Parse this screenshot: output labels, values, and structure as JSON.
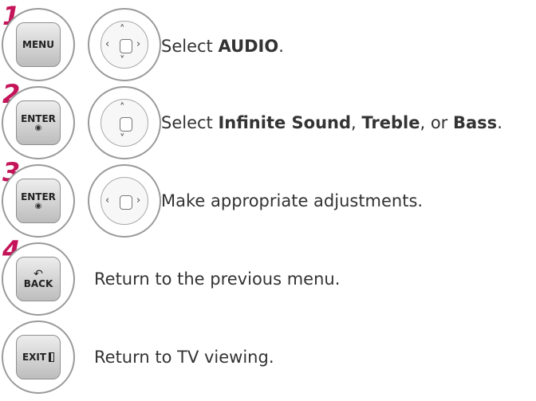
{
  "steps": [
    {
      "number": "1",
      "key_label": "MENU",
      "nav_arrows": [
        "up",
        "down",
        "left",
        "right"
      ],
      "text_parts": {
        "prefix": "Select ",
        "bold1": "AUDIO",
        "suffix": "."
      }
    },
    {
      "number": "2",
      "key_label": "ENTER",
      "key_symbol": "◉",
      "nav_arrows": [
        "up",
        "down"
      ],
      "text_parts": {
        "prefix": "Select ",
        "bold1": "Infinite Sound",
        "sep1": ", ",
        "bold2": "Treble",
        "sep2": ", or ",
        "bold3": "Bass",
        "suffix": "."
      }
    },
    {
      "number": "3",
      "key_label": "ENTER",
      "key_symbol": "◉",
      "nav_arrows": [
        "left",
        "right"
      ],
      "text": "Make appropriate adjustments."
    },
    {
      "number": "4",
      "key_label": "BACK",
      "key_symbol": "↶",
      "text": "Return to the previous menu."
    },
    {
      "number": "",
      "key_label": "EXIT",
      "text": "Return to TV viewing."
    }
  ],
  "icons": {
    "up": "▲",
    "down": "▼",
    "left": "◀",
    "right": "▶"
  }
}
